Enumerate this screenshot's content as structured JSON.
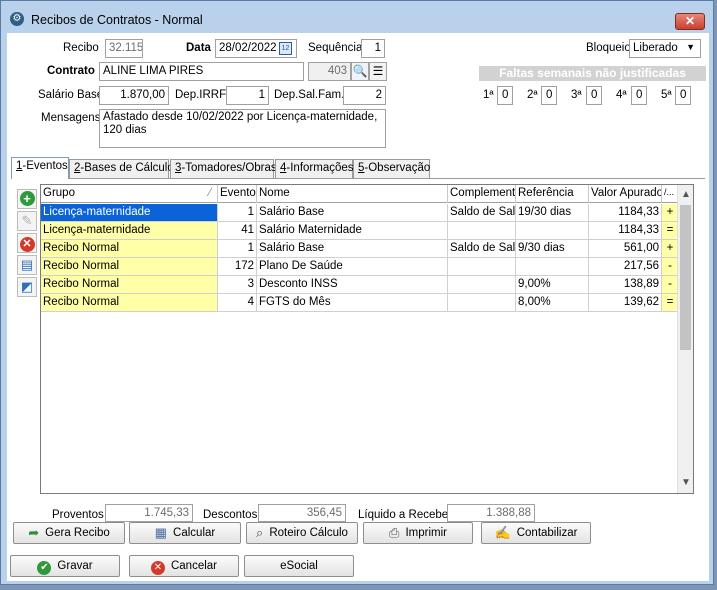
{
  "window": {
    "title": "Recibos de Contratos - Normal",
    "close_label": "✕"
  },
  "form": {
    "recibo_label": "Recibo",
    "recibo_value": "32.115",
    "data_label": "Data",
    "data_value": "28/02/2022",
    "sequencia_label": "Sequência",
    "sequencia_value": "1",
    "bloqueio_label": "Bloqueio",
    "bloqueio_value": "Liberado",
    "contrato_label": "Contrato",
    "contrato_value": "ALINE LIMA PIRES",
    "contrato_code": "403",
    "salario_label": "Salário Base",
    "salario_value": "1.870,00",
    "depirrf_label": "Dep.IRRF",
    "depirrf_value": "1",
    "depsalfam_label": "Dep.Sal.Fam.",
    "depsalfam_value": "2",
    "mensagens_label": "Mensagens",
    "mensagens_line1": "Afastado desde 10/02/2022 por Licença-maternidade,",
    "mensagens_line2": "120 dias"
  },
  "faltas": {
    "title": "Faltas semanais não justificadas",
    "weeks": [
      {
        "label": "1ª",
        "value": "0"
      },
      {
        "label": "2ª",
        "value": "0"
      },
      {
        "label": "3ª",
        "value": "0"
      },
      {
        "label": "4ª",
        "value": "0"
      },
      {
        "label": "5ª",
        "value": "0"
      }
    ]
  },
  "tabs": [
    {
      "key": "1",
      "label": "-Eventos"
    },
    {
      "key": "2",
      "label": "-Bases de Cálculo"
    },
    {
      "key": "3",
      "label": "-Tomadores/Obras"
    },
    {
      "key": "4",
      "label": "-Informações"
    },
    {
      "key": "5",
      "label": "-Observação"
    }
  ],
  "grid": {
    "headers": {
      "grupo": "Grupo",
      "evento": "Evento",
      "nome": "Nome",
      "complemento": "Complemento",
      "referencia": "Referência",
      "valor": "Valor Apurado",
      "ind": "/..."
    },
    "rows": [
      {
        "grupo": "Licença-maternidade",
        "evento": "1",
        "nome": "Salário Base",
        "complemento": "Saldo de Salário",
        "referencia": "19/30 dias",
        "valor": "1184,33",
        "ind": "+"
      },
      {
        "grupo": "Licença-maternidade",
        "evento": "41",
        "nome": "Salário Maternidade",
        "complemento": "",
        "referencia": "",
        "valor": "1184,33",
        "ind": "="
      },
      {
        "grupo": "Recibo Normal",
        "evento": "1",
        "nome": "Salário Base",
        "complemento": "Saldo de Salário",
        "referencia": "9/30 dias",
        "valor": "561,00",
        "ind": "+"
      },
      {
        "grupo": "Recibo Normal",
        "evento": "172",
        "nome": "Plano De Saúde",
        "complemento": "",
        "referencia": "",
        "valor": "217,56",
        "ind": "-"
      },
      {
        "grupo": "Recibo Normal",
        "evento": "3",
        "nome": "Desconto INSS",
        "complemento": "",
        "referencia": "9,00%",
        "valor": "138,89",
        "ind": "-"
      },
      {
        "grupo": "Recibo Normal",
        "evento": "4",
        "nome": "FGTS do Mês",
        "complemento": "",
        "referencia": "8,00%",
        "valor": "139,62",
        "ind": "="
      }
    ]
  },
  "totals": {
    "proventos_label": "Proventos",
    "proventos_value": "1.745,33",
    "descontos_label": "Descontos",
    "descontos_value": "356,45",
    "liquido_label": "Líquido a Receber",
    "liquido_value": "1.388,88"
  },
  "actions": {
    "gera_recibo": "Gera Recibo",
    "calcular": "Calcular",
    "roteiro": "Roteiro Cálculo",
    "imprimir": "Imprimir",
    "contabilizar": "Contabilizar",
    "gravar": "Gravar",
    "cancelar": "Cancelar",
    "esocial": "eSocial"
  },
  "colors": {
    "selection": "#0a64d7",
    "group_bg": "#ffffa8",
    "title_bar": "#b9d1ea"
  }
}
